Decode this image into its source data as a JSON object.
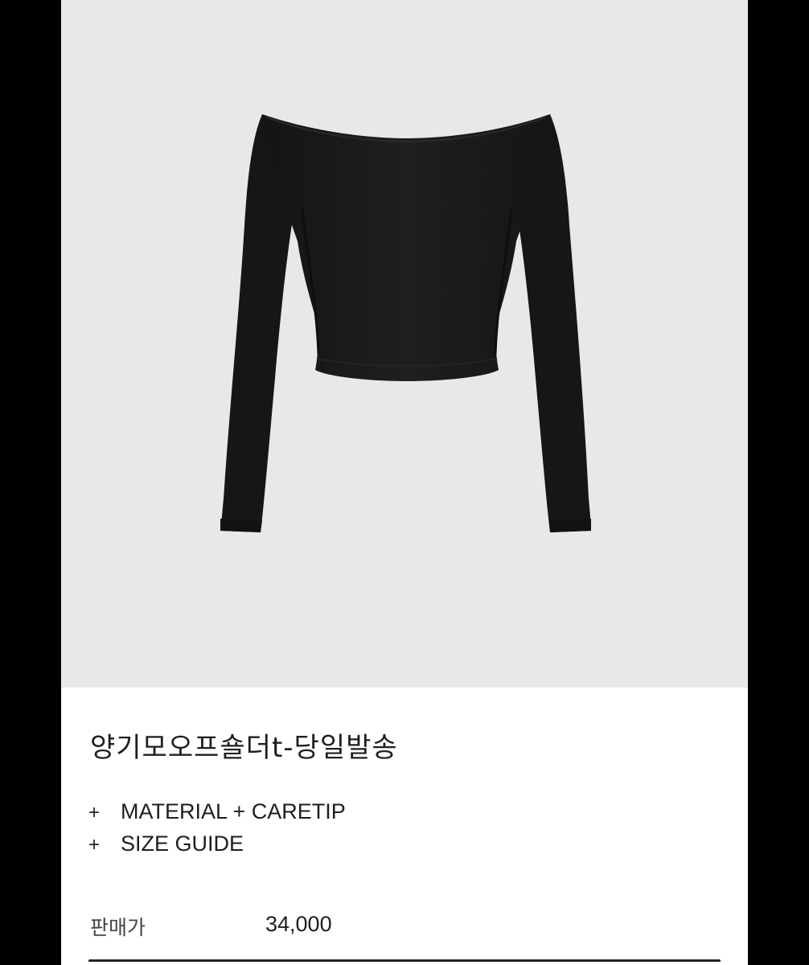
{
  "product": {
    "title": "양기모오프숄더t-당일발송",
    "image_alt": "black off-shoulder long sleeve top",
    "price_label": "판매가",
    "price_value": "34,000"
  },
  "accordion": {
    "items": [
      {
        "icon": "+",
        "label": "MATERIAL + CARETIP"
      },
      {
        "icon": "+",
        "label": "SIZE GUIDE"
      }
    ]
  },
  "colors": {
    "page_background": "#000000",
    "hero_background": "#e8e8e8",
    "garment": "#1a1a1a",
    "text": "#1e1e1e"
  }
}
